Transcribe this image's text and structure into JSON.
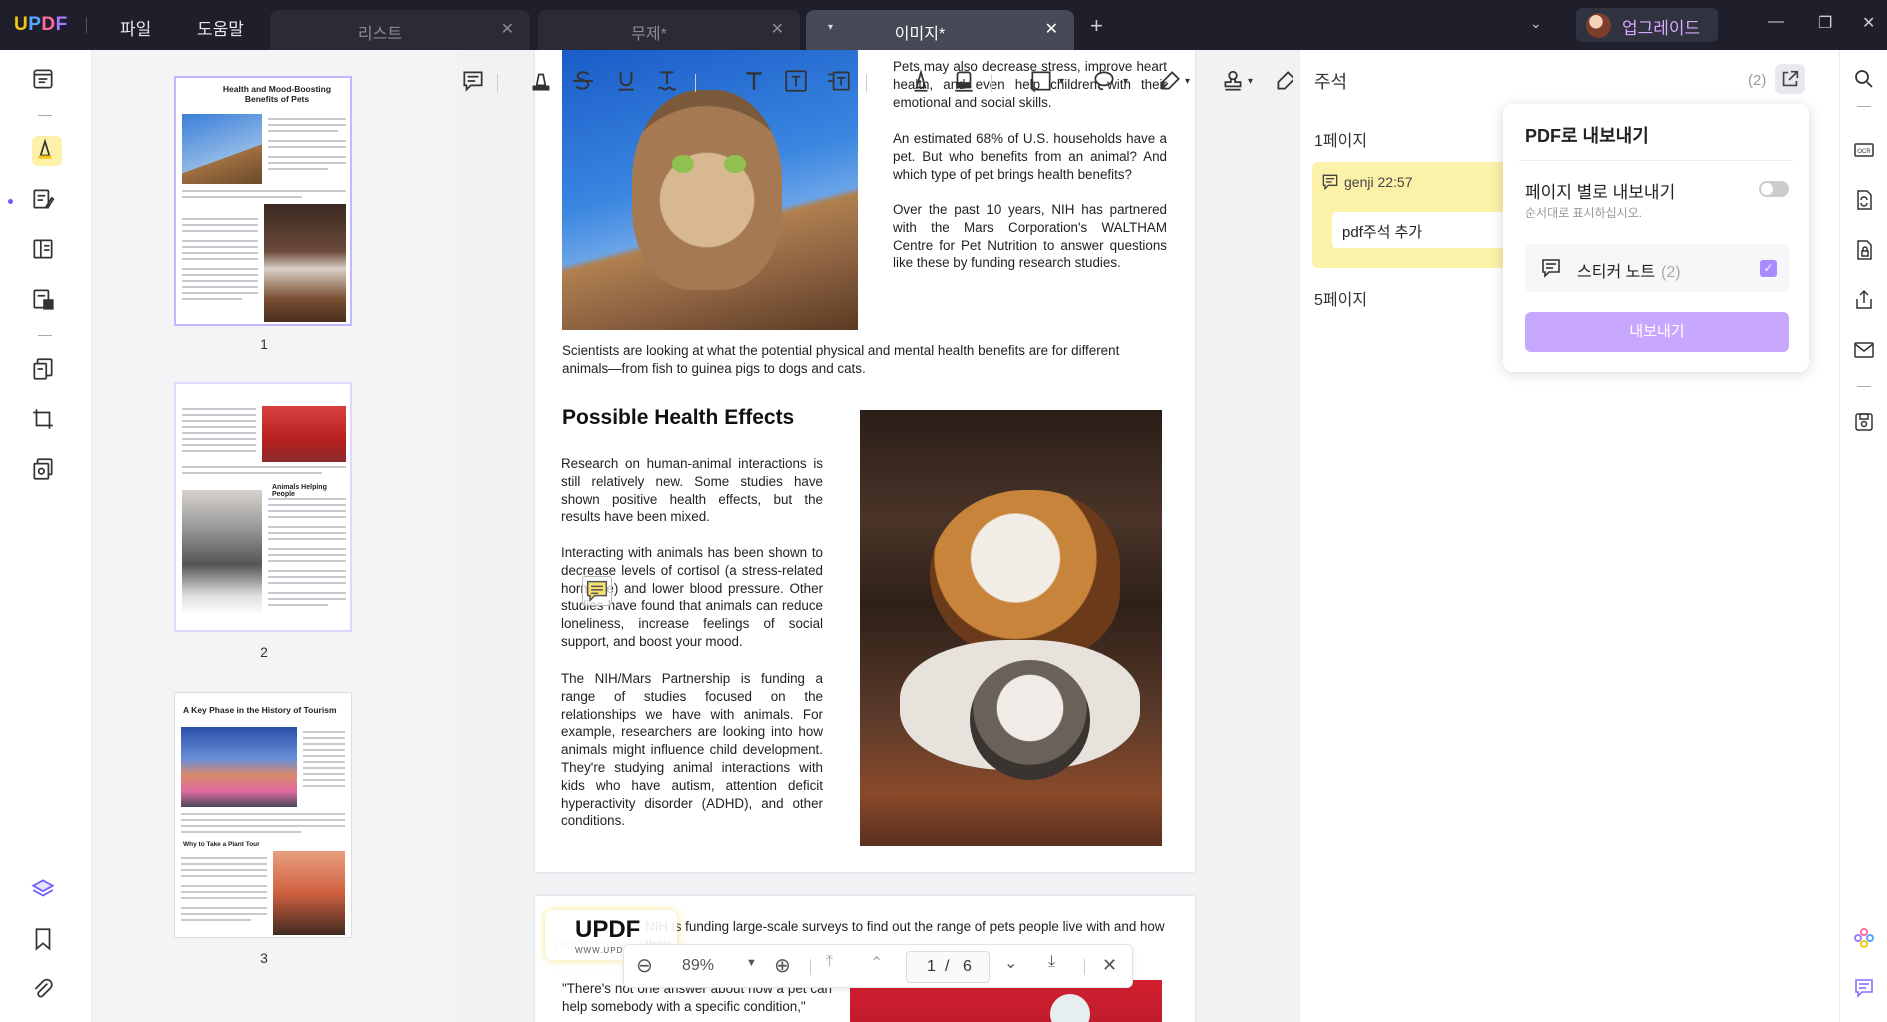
{
  "app": {
    "logo": "UPDF",
    "menus": [
      "파일",
      "도움말"
    ],
    "tabs": [
      {
        "label": "리스트",
        "active": false
      },
      {
        "label": "무제*",
        "active": false
      },
      {
        "label": "이미지*",
        "active": true
      }
    ],
    "upgrade_label": "업그레이드"
  },
  "colors": {
    "accent_purple": "#a78bff",
    "note_yellow": "#fcf1a9",
    "highlight_yellow": "#fdf0a8",
    "titlebar": "#1e1f2b"
  },
  "left_rail": {
    "icons": [
      "reader-icon",
      "comment-icon",
      "edit-pdf-icon",
      "page-view-icon",
      "form-icon",
      "organize-pages-icon",
      "crop-icon",
      "page-tools-icon",
      "layers-icon",
      "bookmark-icon",
      "attachment-icon"
    ]
  },
  "thumbnails": {
    "pages": [
      {
        "number": "1",
        "title": "Health and Mood-Boosting Benefits of Pets"
      },
      {
        "number": "2",
        "title": "Animals Helping People"
      },
      {
        "number": "3",
        "title": "A Key Phase in the History of Tourism",
        "subtitle": "Why to Take a Plant Tour"
      }
    ]
  },
  "annotation_toolbar": {
    "tools": [
      "sticky-note-icon",
      "highlight-icon",
      "strikethrough-icon",
      "underline-icon",
      "squiggly-icon",
      "text-icon",
      "textbox-icon",
      "text-callout-icon",
      "pencil-icon",
      "eraser-icon",
      "shape-icon",
      "lasso-icon",
      "pen-icon",
      "stamp-icon"
    ]
  },
  "document": {
    "page1": {
      "para_right_1": "Pets may also decrease stress, improve heart health, and even help children with their emotional and social skills.",
      "para_right_2": "An estimated 68% of U.S. households have a pet. But who benefits from an animal? And which type of pet brings health benefits?",
      "para_right_3": "Over the past 10 years, NIH has partnered with the Mars Corporation's WALTHAM Centre for Pet Nutrition to answer questions like these by funding research studies.",
      "para_full": "Scientists are looking at what the potential physical and mental health benefits are for different animals—from fish to guinea pigs to dogs and cats.",
      "heading": "Possible Health Effects",
      "para_left_1": "Research on human-animal interactions is still relatively new. Some studies have shown positive health effects, but the results have been mixed.",
      "para_left_2": "Interacting with animals has been shown to decrease levels of cortisol (a stress-related hormone) and lower blood pressure. Other studies have found that animals can reduce loneliness, increase feelings of social support, and boost your mood.",
      "para_left_3": "The NIH/Mars Partnership is funding a range of studies focused on the relationships we have with animals. For example, researchers are looking into how animals might influence child development. They're studying animal interactions with kids who have autism, attention deficit hyperactivity disorder (ADHD), and other conditions."
    },
    "page2": {
      "line1": "NIH is funding large-scale surveys to find out the range of pets people live with and how their",
      "line2": "relationships",
      "quote": "\"There's not one answer about how a pet can help somebody with a specific condition,\""
    },
    "watermark": {
      "logo": "UPDF",
      "url": "WWW.UPDF.COM"
    }
  },
  "zoom_bar": {
    "zoom": "89%",
    "current_page": "1",
    "separator": "/",
    "total_pages": "6"
  },
  "comments_panel": {
    "title": "주석",
    "count": "(2)",
    "page1_label": "1페이지",
    "note_author": "genji 22:57",
    "note_text": "pdf주석 추가",
    "page5_label": "5페이지"
  },
  "export_popover": {
    "title": "PDF로 내보내기",
    "option_label": "페이지 별로 내보내기",
    "option_sub": "순서대로 표시하십시오.",
    "option_enabled": false,
    "row_label": "스티커 노트",
    "row_count": "(2)",
    "row_checked": true,
    "button_label": "내보내기"
  },
  "right_rail": {
    "icons": [
      "search-icon",
      "ocr-icon",
      "convert-icon",
      "protect-icon",
      "share-icon",
      "email-icon",
      "save-icon",
      "ai-assistant-icon",
      "comments-panel-icon"
    ]
  }
}
